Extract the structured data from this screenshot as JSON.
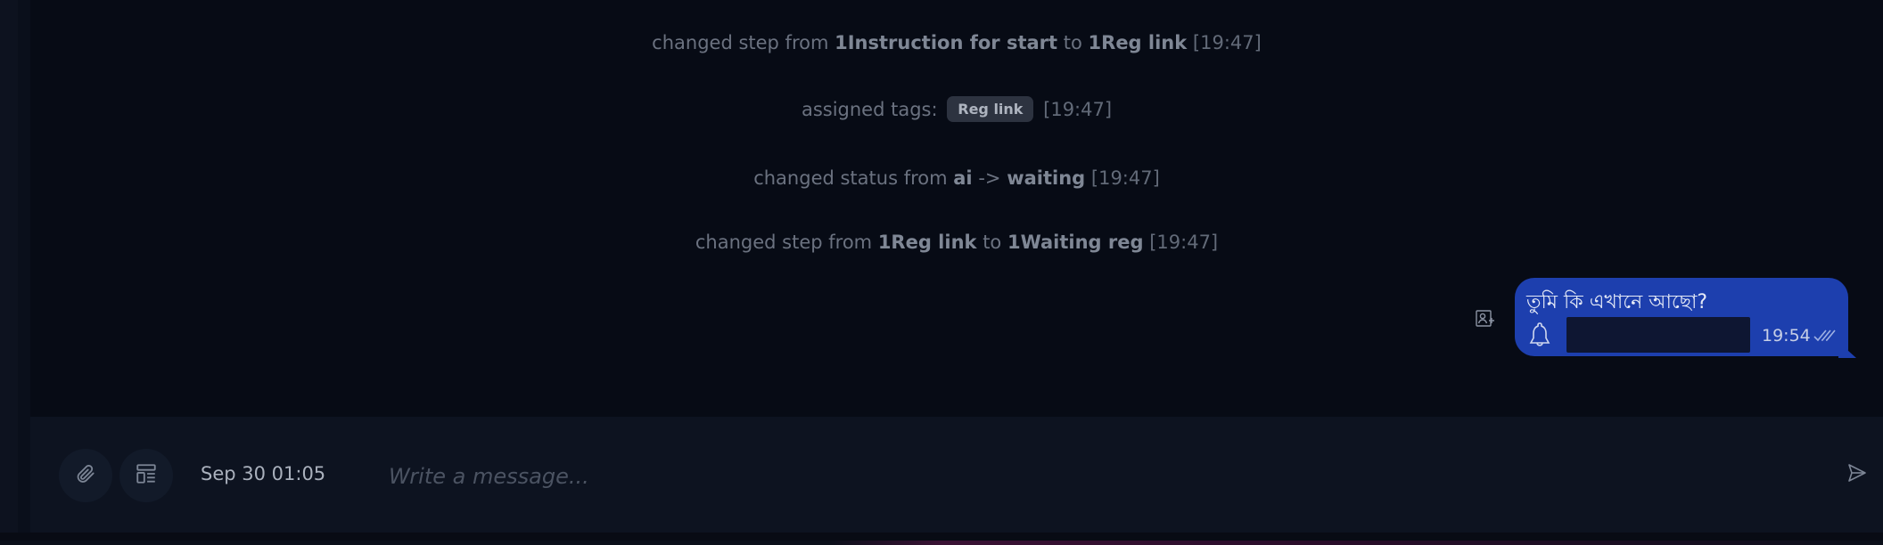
{
  "system_events": [
    {
      "prefix": "changed step from",
      "from": "1Instruction for start",
      "mid": "to",
      "to": "1Reg link",
      "time": "[19:47]"
    },
    {
      "prefix": "assigned tags:",
      "tag": "Reg link",
      "time": "[19:47]"
    },
    {
      "prefix": "changed status from",
      "from": "ai",
      "mid": "->",
      "to": "waiting",
      "time": "[19:47]"
    },
    {
      "prefix": "changed step from",
      "from": "1Reg link",
      "mid": "to",
      "to": "1Waiting reg",
      "time": "[19:47]"
    }
  ],
  "message": {
    "text": "তুমি কি এখানে আছো?",
    "time": "19:54",
    "status_icon": "double-check-icon",
    "avatar_icon": "bell-icon",
    "side_icon": "assign-contact-icon",
    "bubble_color": "#1d3fae"
  },
  "composer": {
    "date": "Sep 30 01:05",
    "placeholder": "Write a message...",
    "attach_icon": "paperclip-icon",
    "template_icon": "template-icon",
    "send_icon": "send-icon"
  }
}
